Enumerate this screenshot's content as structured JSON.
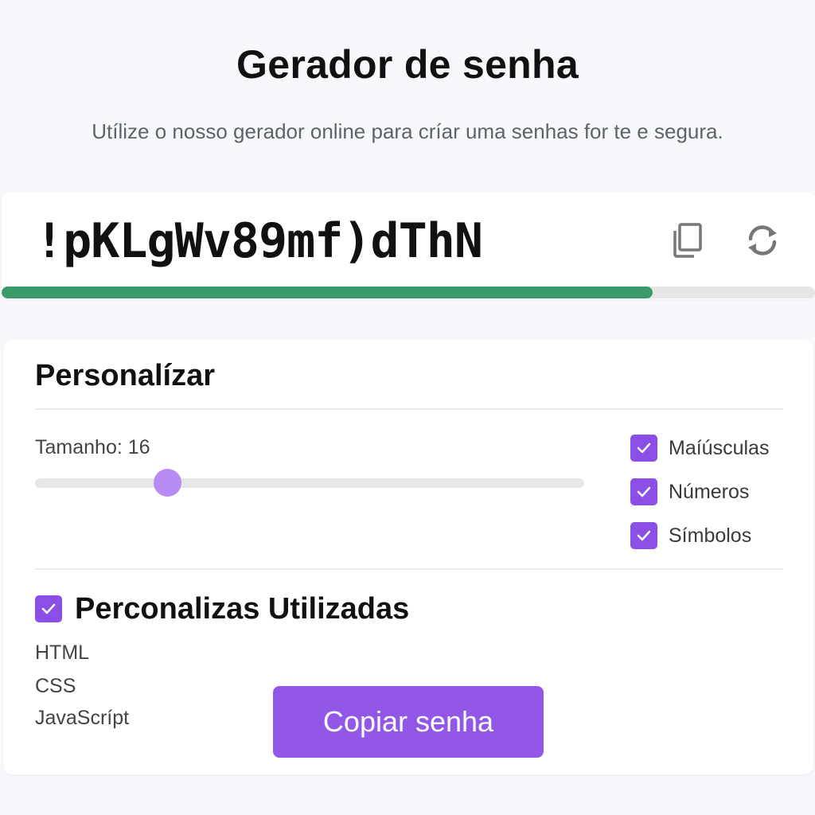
{
  "header": {
    "title": "Gerador de senha",
    "subtitle": "Utílize o nosso gerador online para críar uma senhas for te e segura."
  },
  "password": {
    "value": "!pKLgWv89mf)dThN",
    "strength_fraction": 0.8,
    "strength_color": "#3a9a6a",
    "copy_icon": "copy-icon",
    "refresh_icon": "refresh-icon"
  },
  "options": {
    "heading": "Personalízar",
    "length_label": "Tamanho: 16",
    "length_value": 16,
    "checkboxes": [
      {
        "label": "Maíúsculas",
        "checked": true
      },
      {
        "label": "Números",
        "checked": true
      },
      {
        "label": "Símbolos",
        "checked": true
      }
    ]
  },
  "used": {
    "title": "Perconalizas Utilizadas",
    "checked": true,
    "items": [
      "HTML",
      "CSS",
      "JavaScrípt"
    ]
  },
  "actions": {
    "copy_label": "Copiar senha"
  },
  "colors": {
    "accent": "#9357e8",
    "checkbox": "#8b4fe6",
    "slider_thumb": "#b68cf2"
  }
}
